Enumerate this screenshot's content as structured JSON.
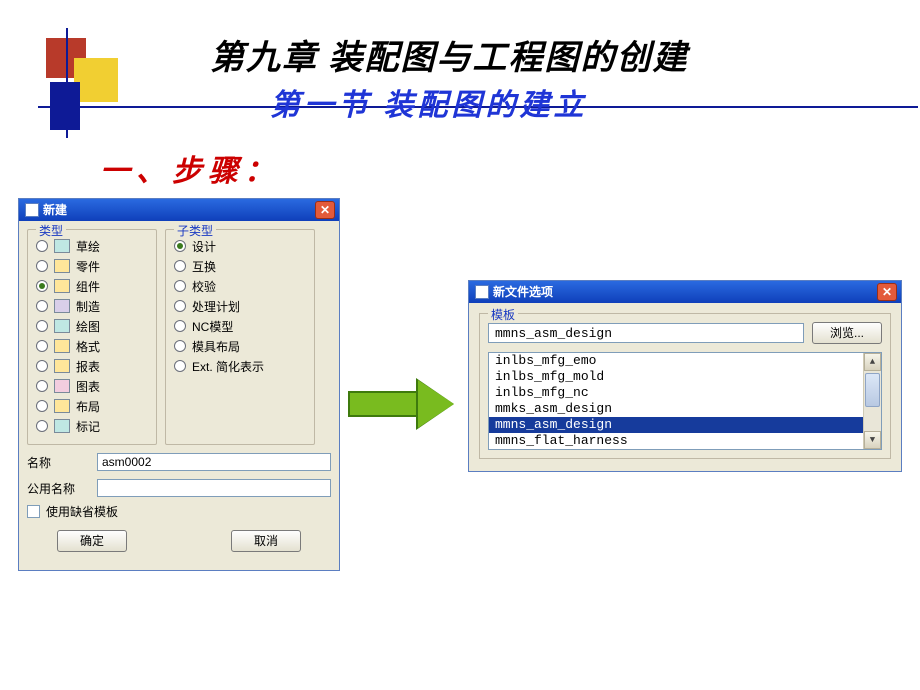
{
  "chapter_title": "第九章 装配图与工程图的创建",
  "section_title": "第一节  装配图的建立",
  "step_heading": "一、步骤：",
  "dlg1": {
    "title": "新建",
    "group_type_label": "类型",
    "group_subtype_label": "子类型",
    "types": [
      {
        "label": "草绘",
        "selected": false,
        "icon": "ic-cyan"
      },
      {
        "label": "零件",
        "selected": false,
        "icon": "ic-yellow"
      },
      {
        "label": "组件",
        "selected": true,
        "icon": "ic-yellow"
      },
      {
        "label": "制造",
        "selected": false,
        "icon": "ic-purple"
      },
      {
        "label": "绘图",
        "selected": false,
        "icon": "ic-cyan"
      },
      {
        "label": "格式",
        "selected": false,
        "icon": "ic-yellow"
      },
      {
        "label": "报表",
        "selected": false,
        "icon": "ic-yellow"
      },
      {
        "label": "图表",
        "selected": false,
        "icon": "ic-pink"
      },
      {
        "label": "布局",
        "selected": false,
        "icon": "ic-yellow"
      },
      {
        "label": "标记",
        "selected": false,
        "icon": "ic-cyan"
      }
    ],
    "subtypes": [
      {
        "label": "设计",
        "selected": true
      },
      {
        "label": "互换",
        "selected": false
      },
      {
        "label": "校验",
        "selected": false
      },
      {
        "label": "处理计划",
        "selected": false
      },
      {
        "label": "NC模型",
        "selected": false
      },
      {
        "label": "模具布局",
        "selected": false
      },
      {
        "label": "Ext. 简化表示",
        "selected": false
      }
    ],
    "name_label": "名称",
    "public_name_label": "公用名称",
    "name_value": "asm0002",
    "public_name_value": "",
    "use_default_template_label": "使用缺省模板",
    "use_default_template_checked": false,
    "ok_label": "确定",
    "cancel_label": "取消"
  },
  "dlg2": {
    "title": "新文件选项",
    "group_template_label": "模板",
    "template_value": "mmns_asm_design",
    "browse_label": "浏览...",
    "templates": [
      "inlbs_mfg_emo",
      "inlbs_mfg_mold",
      "inlbs_mfg_nc",
      "mmks_asm_design",
      "mmns_asm_design",
      "mmns_flat_harness"
    ],
    "selected_template_index": 4
  }
}
